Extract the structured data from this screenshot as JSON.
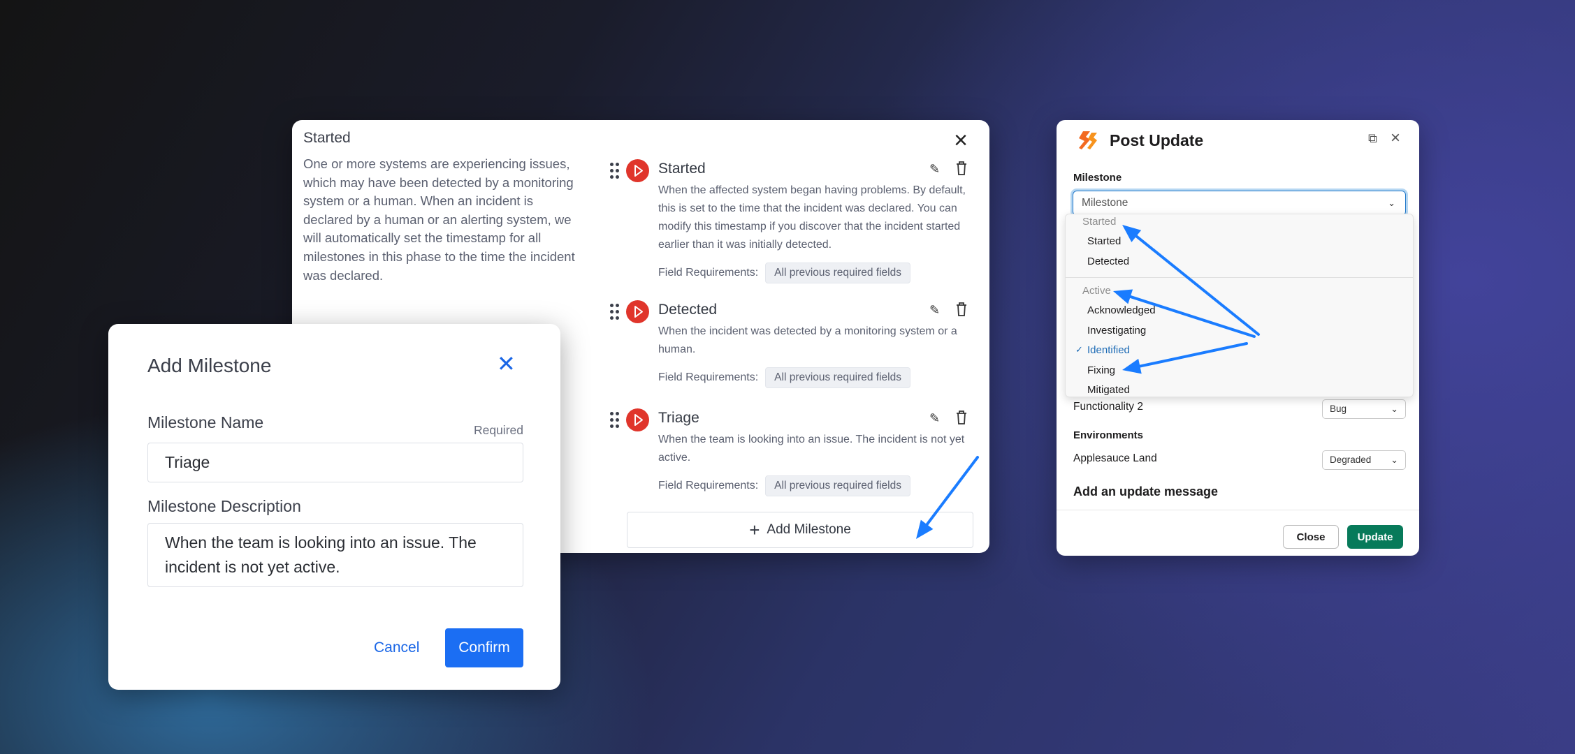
{
  "phase_dialog": {
    "title": "Started",
    "description": "One or more systems are experiencing issues, which may have been detected by a monitoring system or a human. When an incident is declared by a human or an alerting system, we will automatically set the timestamp for all milestones in this phase to the time the incident was declared.",
    "field_requirements_label": "Field Requirements:",
    "milestones": [
      {
        "title": "Started",
        "description": "When the affected system began having problems. By default, this is set to the time that the incident was declared. You can modify this timestamp if you discover that the incident started earlier than it was initially detected.",
        "requirement": "All previous required fields"
      },
      {
        "title": "Detected",
        "description": "When the incident was detected by a monitoring system or a human.",
        "requirement": "All previous required fields"
      },
      {
        "title": "Triage",
        "description": "When the team is looking into an issue. The incident is not yet active.",
        "requirement": "All previous required fields"
      }
    ],
    "add_milestone_label": "Add Milestone",
    "milestone_icon_color": "#e0352b"
  },
  "add_milestone_modal": {
    "title": "Add Milestone",
    "name_label": "Milestone Name",
    "required_label": "Required",
    "name_value": "Triage",
    "description_label": "Milestone Description",
    "description_value": "When the team is looking into an issue. The incident is not yet active.",
    "cancel_label": "Cancel",
    "confirm_label": "Confirm",
    "accent_color": "#1b6ef3"
  },
  "post_update": {
    "title": "Post Update",
    "milestone_label": "Milestone",
    "milestone_placeholder": "Milestone",
    "groups": [
      {
        "header": "Started",
        "items": [
          "Started",
          "Detected"
        ]
      },
      {
        "header": "Active",
        "items": [
          "Acknowledged",
          "Investigating",
          "Identified",
          "Fixing",
          "Mitigated"
        ]
      }
    ],
    "selected_item": "Identified",
    "functionality_label": "Functionality 2",
    "functionality_value": "Bug",
    "environments_label": "Environments",
    "environment_name": "Applesauce Land",
    "environment_value": "Degraded",
    "message_heading": "Add an update message",
    "close_label": "Close",
    "update_label": "Update",
    "update_color": "#077a5a"
  },
  "annotation_arrow_color": "#1a7cff"
}
